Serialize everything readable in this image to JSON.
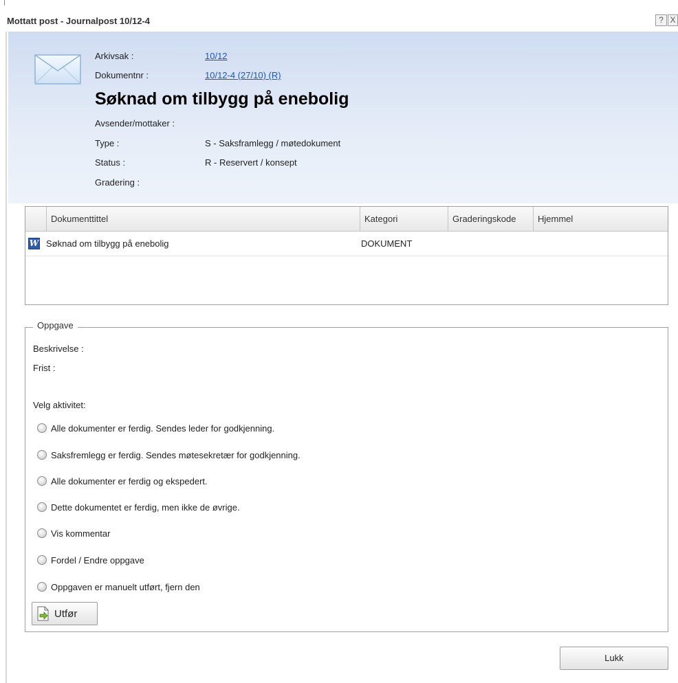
{
  "window": {
    "title": "Mottatt post - Journalpost 10/12-4",
    "help_glyph": "?",
    "close_glyph": "X"
  },
  "header": {
    "arkivsak_label": "Arkivsak :",
    "arkivsak_value": "10/12",
    "dokumentnr_label": "Dokumentnr :",
    "dokumentnr_value": "10/12-4 (27/10) (R)",
    "heading": "Søknad om tilbygg på enebolig",
    "avsender_label": "Avsender/mottaker :",
    "type_label": "Type :",
    "type_value": "S - Saksframlegg / møtedokument",
    "status_label": "Status :",
    "status_value": "R - Reservert / konsept",
    "gradering_label": "Gradering :"
  },
  "documents": {
    "columns": [
      "Dokumenttittel",
      "Kategori",
      "Graderingskode",
      "Hjemmel"
    ],
    "rows": [
      {
        "icon": "word-icon",
        "icon_glyph": "W",
        "title": "Søknad om tilbygg på enebolig",
        "kategori": "DOKUMENT",
        "graderingskode": "",
        "hjemmel": ""
      }
    ]
  },
  "task": {
    "legend": "Oppgave",
    "beskrivelse_label": "Beskrivelse :",
    "frist_label": "Frist :",
    "velg_label": "Velg aktivitet:",
    "options": [
      "Alle dokumenter er ferdig. Sendes leder for godkjenning.",
      "Saksfremlegg er ferdig. Sendes møtesekretær for godkjenning.",
      "Alle dokumenter er ferdig og ekspedert.",
      "Dette dokumentet er ferdig, men ikke de øvrige.",
      "Vis kommentar",
      "Fordel / Endre oppgave",
      "Oppgaven er manuelt utført, fjern den"
    ],
    "execute_label": "Utfør"
  },
  "footer": {
    "close_label": "Lukk"
  },
  "colors": {
    "link": "#1a55cc",
    "header_gradient_top": "#cfdcf1",
    "header_gradient_bottom": "#eef3fa"
  }
}
